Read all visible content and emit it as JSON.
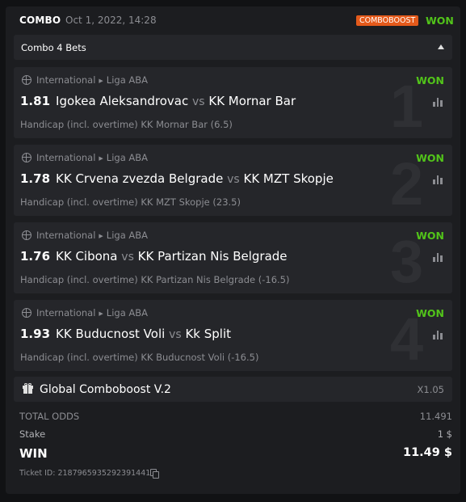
{
  "header": {
    "type": "COMBO",
    "datetime": "Oct 1, 2022, 14:28",
    "badge": "COMBOBOOST",
    "status": "WON"
  },
  "combo": {
    "title": "Combo 4 Bets"
  },
  "legs": [
    {
      "index": "1",
      "category": "International",
      "league": "Liga ABA",
      "status": "WON",
      "odds": "1.81",
      "home": "Igokea Aleksandrovac",
      "vs": "vs",
      "away": "KK Mornar Bar",
      "selection": "Handicap (incl. overtime) KK Mornar Bar (6.5)"
    },
    {
      "index": "2",
      "category": "International",
      "league": "Liga ABA",
      "status": "WON",
      "odds": "1.78",
      "home": "KK Crvena zvezda Belgrade",
      "vs": "vs",
      "away": "KK MZT Skopje",
      "selection": "Handicap (incl. overtime) KK MZT Skopje (23.5)"
    },
    {
      "index": "3",
      "category": "International",
      "league": "Liga ABA",
      "status": "WON",
      "odds": "1.76",
      "home": "KK Cibona",
      "vs": "vs",
      "away": "KK Partizan Nis Belgrade",
      "selection": "Handicap (incl. overtime) KK Partizan Nis Belgrade (-16.5)"
    },
    {
      "index": "4",
      "category": "International",
      "league": "Liga ABA",
      "status": "WON",
      "odds": "1.93",
      "home": "KK Buducnost Voli",
      "vs": "vs",
      "away": "Kk Split",
      "selection": "Handicap (incl. overtime) KK Buducnost Voli (-16.5)"
    }
  ],
  "boost": {
    "title": "Global Comboboost V.2",
    "multiplier": "X1.05"
  },
  "summary": {
    "total_odds_label": "TOTAL ODDS",
    "total_odds": "11.491",
    "stake_label": "Stake",
    "stake": "1 $",
    "win_label": "WIN",
    "win": "11.49 $"
  },
  "ticket": {
    "label": "Ticket ID: 2187965935292391441"
  },
  "icons": {
    "sport": "basketball-icon",
    "stats": "stats-icon",
    "gift": "gift-icon",
    "copy": "copy-icon",
    "caret": "caret-up-icon"
  },
  "colors": {
    "won": "#52c41a",
    "boost_badge": "#e45a1b",
    "card": "#1c1d20",
    "panel": "#25262a"
  }
}
